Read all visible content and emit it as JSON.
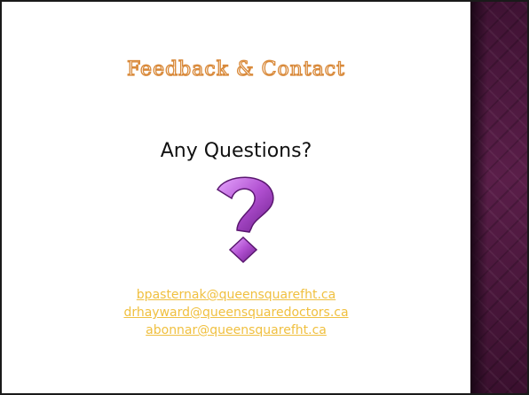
{
  "slide": {
    "title": "Feedback & Contact",
    "subtitle": "Any Questions?",
    "graphic": "question-mark-icon",
    "emails": [
      "bpasternak@queensquarefht.ca",
      "drhayward@queensquaredoctors.ca",
      "abonnar@queensquarefht.ca"
    ]
  },
  "colors": {
    "title_outline": "#d98a3b",
    "link": "#f0c040",
    "question_mark": "#b04fd0",
    "side_panel": "#3b1030"
  }
}
